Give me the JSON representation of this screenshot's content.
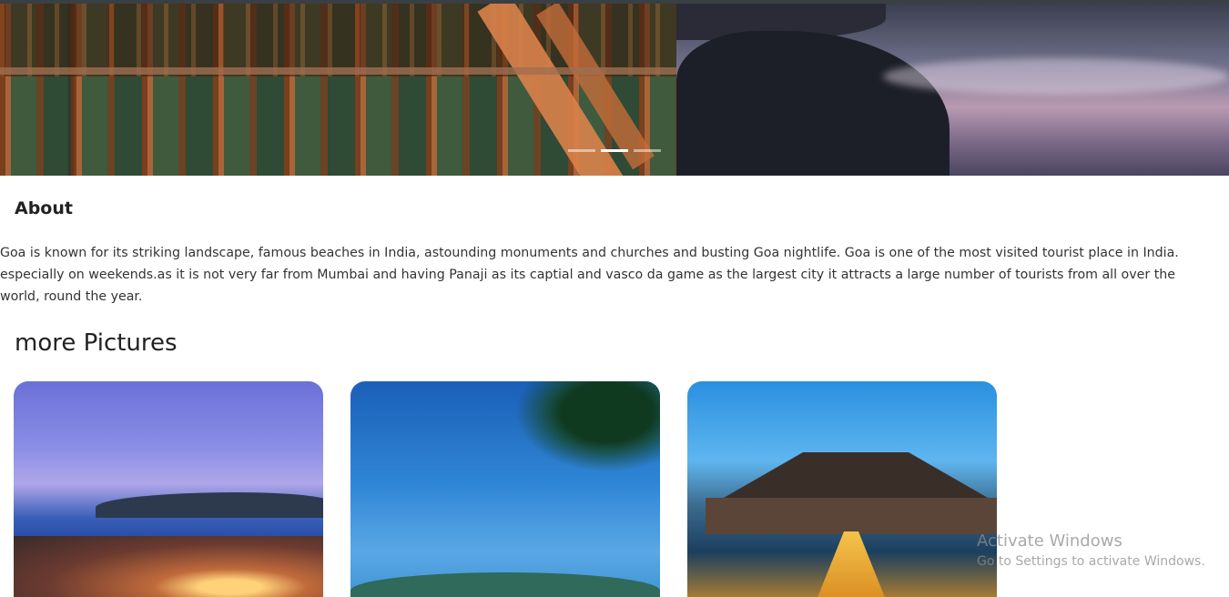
{
  "about": {
    "heading": "About",
    "text": "Goa is known for its striking landscape, famous beaches in India, astounding monuments and churches and busting Goa nightlife. Goa is one of the most visited tourist place in India. especially on weekends.as it is not very far from Mumbai and having Panaji as its captial and vasco da game as the largest city it attracts a large number of tourists from all over the world, round the year."
  },
  "gallery": {
    "heading": "more Pictures"
  },
  "carousel": {
    "slide_count": 3,
    "active_index": 1
  },
  "watermark": {
    "title": "Activate Windows",
    "subtitle": "Go to Settings to activate Windows."
  }
}
